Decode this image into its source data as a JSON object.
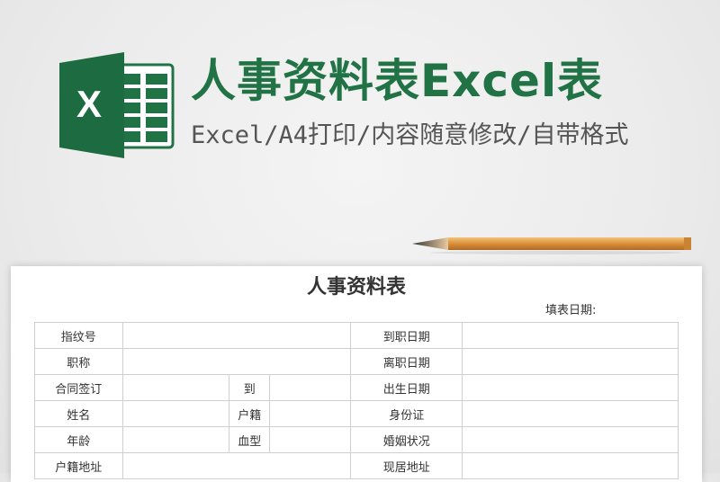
{
  "banner": {
    "title": "人事资料表Excel表",
    "subtitle": "Excel/A4打印/内容随意修改/自带格式",
    "logo_letter": "X",
    "brand_color": "#217346"
  },
  "form": {
    "title": "人事资料表",
    "fill_date_label": "填表日期:",
    "labels": {
      "fingerprint_no": "指纹号",
      "hire_date": "到职日期",
      "job_title": "职称",
      "leave_date": "离职日期",
      "contract_sign": "合同签订",
      "to": "到",
      "birth_date": "出生日期",
      "name": "姓名",
      "household_reg": "户籍",
      "id_card": "身份证",
      "age": "年龄",
      "blood_type": "血型",
      "marital_status": "婚姻状况",
      "household_address": "户籍地址",
      "current_address": "现居地址"
    }
  }
}
